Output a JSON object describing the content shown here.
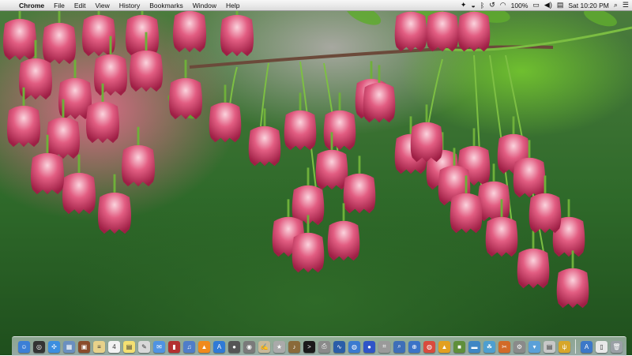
{
  "menubar": {
    "apple_icon": "apple-icon",
    "app_name": "Chrome",
    "menus": [
      "File",
      "Edit",
      "View",
      "History",
      "Bookmarks",
      "Window",
      "Help"
    ],
    "battery": "100%",
    "clock": "Sat 10:20 PM",
    "status_icons": [
      "dropbox-icon",
      "battery-charge-icon",
      "bluetooth-icon",
      "timemachine-icon",
      "wifi-icon",
      "display-icon",
      "volume-icon",
      "flag-icon",
      "search-icon",
      "list-icon"
    ]
  },
  "wallpaper": {
    "description_colors": {
      "flower": "#c8365e",
      "flower_light": "#f1b5c6",
      "leaf": "#5faa2f",
      "bg_green": "#2f6a2a"
    }
  },
  "dock": {
    "icons": [
      {
        "name": "finder-icon",
        "color": "#3c7fd6",
        "glyph": "☺"
      },
      {
        "name": "dashboard-icon",
        "color": "#333333",
        "glyph": "◎"
      },
      {
        "name": "safari-icon",
        "color": "#3b8ee0",
        "glyph": "✣"
      },
      {
        "name": "preview-icon",
        "color": "#6a8fc0",
        "glyph": "▦"
      },
      {
        "name": "photo-icon",
        "color": "#8a4b2b",
        "glyph": "▣"
      },
      {
        "name": "notes-icon",
        "color": "#e8d28a",
        "glyph": "≡"
      },
      {
        "name": "calendar-icon",
        "color": "#f2f2f2",
        "glyph": "4"
      },
      {
        "name": "stickies-icon",
        "color": "#f4e071",
        "glyph": "▤"
      },
      {
        "name": "textedit-icon",
        "color": "#d8d8d8",
        "glyph": "✎"
      },
      {
        "name": "ichat-icon",
        "color": "#4f93e3",
        "glyph": "✉"
      },
      {
        "name": "contacts-icon",
        "color": "#b33030",
        "glyph": "▮"
      },
      {
        "name": "itunes-icon",
        "color": "#4f7dc9",
        "glyph": "♫"
      },
      {
        "name": "vlc-icon",
        "color": "#f08a1c",
        "glyph": "▲"
      },
      {
        "name": "appstore-icon",
        "color": "#2f7ad6",
        "glyph": "A"
      },
      {
        "name": "facetime-icon",
        "color": "#555555",
        "glyph": "●"
      },
      {
        "name": "photobooth-icon",
        "color": "#7a7a7a",
        "glyph": "◉"
      },
      {
        "name": "script-icon",
        "color": "#c9b998",
        "glyph": "✍"
      },
      {
        "name": "imovie-icon",
        "color": "#aaaaaa",
        "glyph": "★"
      },
      {
        "name": "garageband-icon",
        "color": "#8a6a3a",
        "glyph": "♪"
      },
      {
        "name": "terminal-icon",
        "color": "#1a1a1a",
        "glyph": ">"
      },
      {
        "name": "printer-icon",
        "color": "#8a8a8a",
        "glyph": "⎙"
      },
      {
        "name": "activity-monitor-icon",
        "color": "#2a5ea8",
        "glyph": "∿"
      },
      {
        "name": "network-icon",
        "color": "#3a7ad0",
        "glyph": "◍"
      },
      {
        "name": "globe-icon",
        "color": "#2f55c8",
        "glyph": "●"
      },
      {
        "name": "utility-icon",
        "color": "#9a9a9a",
        "glyph": "⌗"
      },
      {
        "name": "search-icon",
        "color": "#3e6fb8",
        "glyph": "⌕"
      },
      {
        "name": "opera-icon",
        "color": "#3b73c7",
        "glyph": "⊕"
      },
      {
        "name": "chrome-icon",
        "color": "#d94b3d",
        "glyph": "◍"
      },
      {
        "name": "app-icon",
        "color": "#e2a020",
        "glyph": "▲"
      },
      {
        "name": "minecraft-icon",
        "color": "#5f8f3a",
        "glyph": "■"
      },
      {
        "name": "folder-icon",
        "color": "#3f86c4",
        "glyph": "▬"
      },
      {
        "name": "game-icon",
        "color": "#4e9fd0",
        "glyph": "☘"
      },
      {
        "name": "tool-icon",
        "color": "#d26a28",
        "glyph": "✂"
      },
      {
        "name": "prefs-icon",
        "color": "#8a8a8a",
        "glyph": "⚙"
      },
      {
        "name": "downloads-icon",
        "color": "#5aa0d8",
        "glyph": "▾"
      },
      {
        "name": "stack-icon",
        "color": "#c8c8c8",
        "glyph": "▤"
      },
      {
        "name": "trophy-icon",
        "color": "#d7a62a",
        "glyph": "ψ"
      }
    ],
    "right_icons": [
      {
        "name": "applications-folder-icon",
        "color": "#3c78c8",
        "glyph": "A"
      },
      {
        "name": "document-icon",
        "color": "#e8e8e8",
        "glyph": "▯"
      },
      {
        "name": "trash-icon",
        "color": "#9aa0a6",
        "glyph": "🗑"
      }
    ]
  }
}
